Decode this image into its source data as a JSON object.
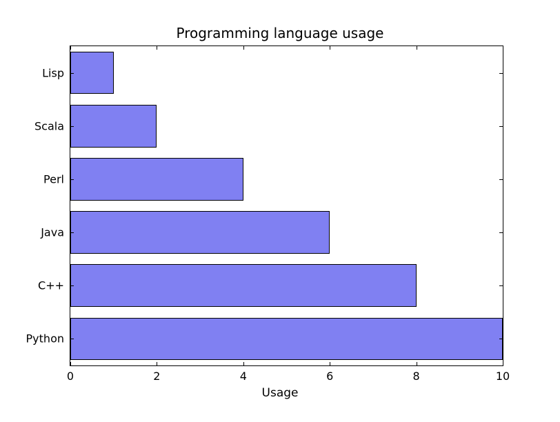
{
  "chart_data": {
    "type": "bar",
    "orientation": "horizontal",
    "title": "Programming language usage",
    "xlabel": "Usage",
    "ylabel": "",
    "categories": [
      "Python",
      "C++",
      "Java",
      "Perl",
      "Scala",
      "Lisp"
    ],
    "values": [
      10,
      8,
      6,
      4,
      2,
      1
    ],
    "xlim": [
      0,
      10
    ],
    "xticks": [
      0,
      2,
      4,
      6,
      8,
      10
    ],
    "bar_color": "#8080f2"
  }
}
